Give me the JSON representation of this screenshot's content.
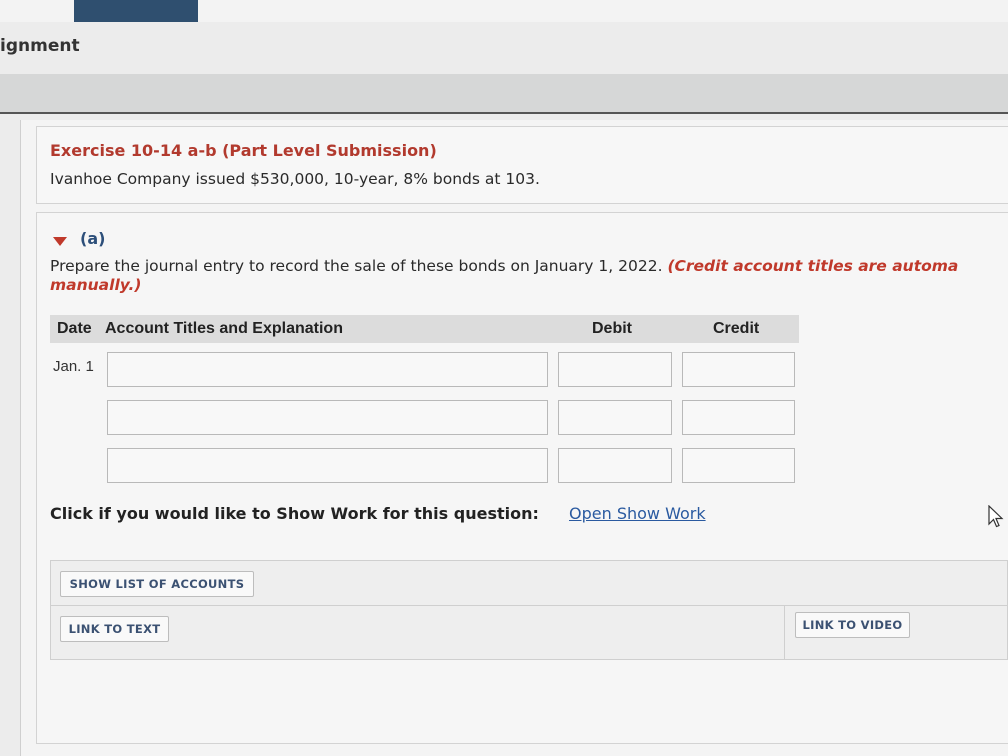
{
  "nav": {
    "tabs": [
      "",
      "",
      "",
      "",
      ""
    ]
  },
  "assignment": {
    "title_fragment": "ignment"
  },
  "exercise": {
    "title": "Exercise 10-14 a-b (Part Level Submission)",
    "description": "Ivanhoe Company issued $530,000, 10-year, 8% bonds at 103."
  },
  "part": {
    "label": "(a)",
    "instruction": "Prepare the journal entry to record the sale of these bonds on January 1, 2022.",
    "instruction_note": "(Credit account titles are automa",
    "instruction_note_2": "manually.)"
  },
  "journal": {
    "headers": {
      "date": "Date",
      "account": "Account Titles and Explanation",
      "debit": "Debit",
      "credit": "Credit"
    },
    "date_value": "Jan. 1",
    "rows": [
      {
        "account": "",
        "debit": "",
        "credit": ""
      },
      {
        "account": "",
        "debit": "",
        "credit": ""
      },
      {
        "account": "",
        "debit": "",
        "credit": ""
      }
    ]
  },
  "show_work": {
    "question": "Click if you would like to Show Work for this question:",
    "link": "Open Show Work"
  },
  "buttons": {
    "show_list": "SHOW LIST OF ACCOUNTS",
    "link_text": "LINK TO TEXT",
    "link_video": "LINK TO VIDEO"
  },
  "colors": {
    "accent_red": "#c0392b",
    "link_blue": "#2a5aa0",
    "nav_active": "#2f4f6f"
  }
}
